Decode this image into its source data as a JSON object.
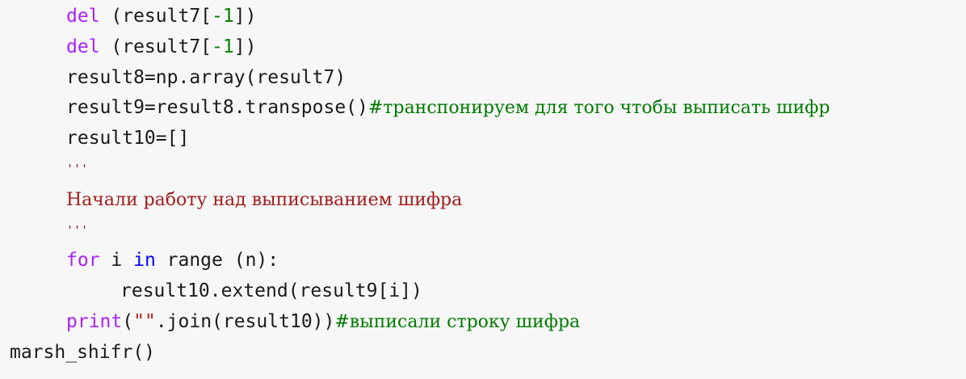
{
  "code": {
    "l1": {
      "kw": "del",
      "a": " (result7[",
      "num": "-1",
      "b": "])"
    },
    "l2": {
      "kw": "del",
      "a": " (result7[",
      "num": "-1",
      "b": "])"
    },
    "l3": {
      "text": "result8=np.array(result7)"
    },
    "l4": {
      "text": "result9=result8.transpose()",
      "comment": "#транспонируем для того чтобы выписать шифр"
    },
    "l5": {
      "text": "result10=[]"
    },
    "l6": {
      "quotes": "'''"
    },
    "l7": {
      "doc": "Начали работу над выписыванием шифра"
    },
    "l8": {
      "quotes": "'''"
    },
    "l9": {
      "kw_for": "for",
      "a": " i ",
      "kw_in": "in",
      "b": " range (n):"
    },
    "l10": {
      "text": "result10.extend(result9[i])"
    },
    "l11": {
      "kw": "print",
      "a": "(",
      "str": "\"\"",
      "b": ".join(result10))",
      "comment": "#выписали строку шифра"
    },
    "l12": {
      "text": "marsh_shifr()"
    }
  }
}
